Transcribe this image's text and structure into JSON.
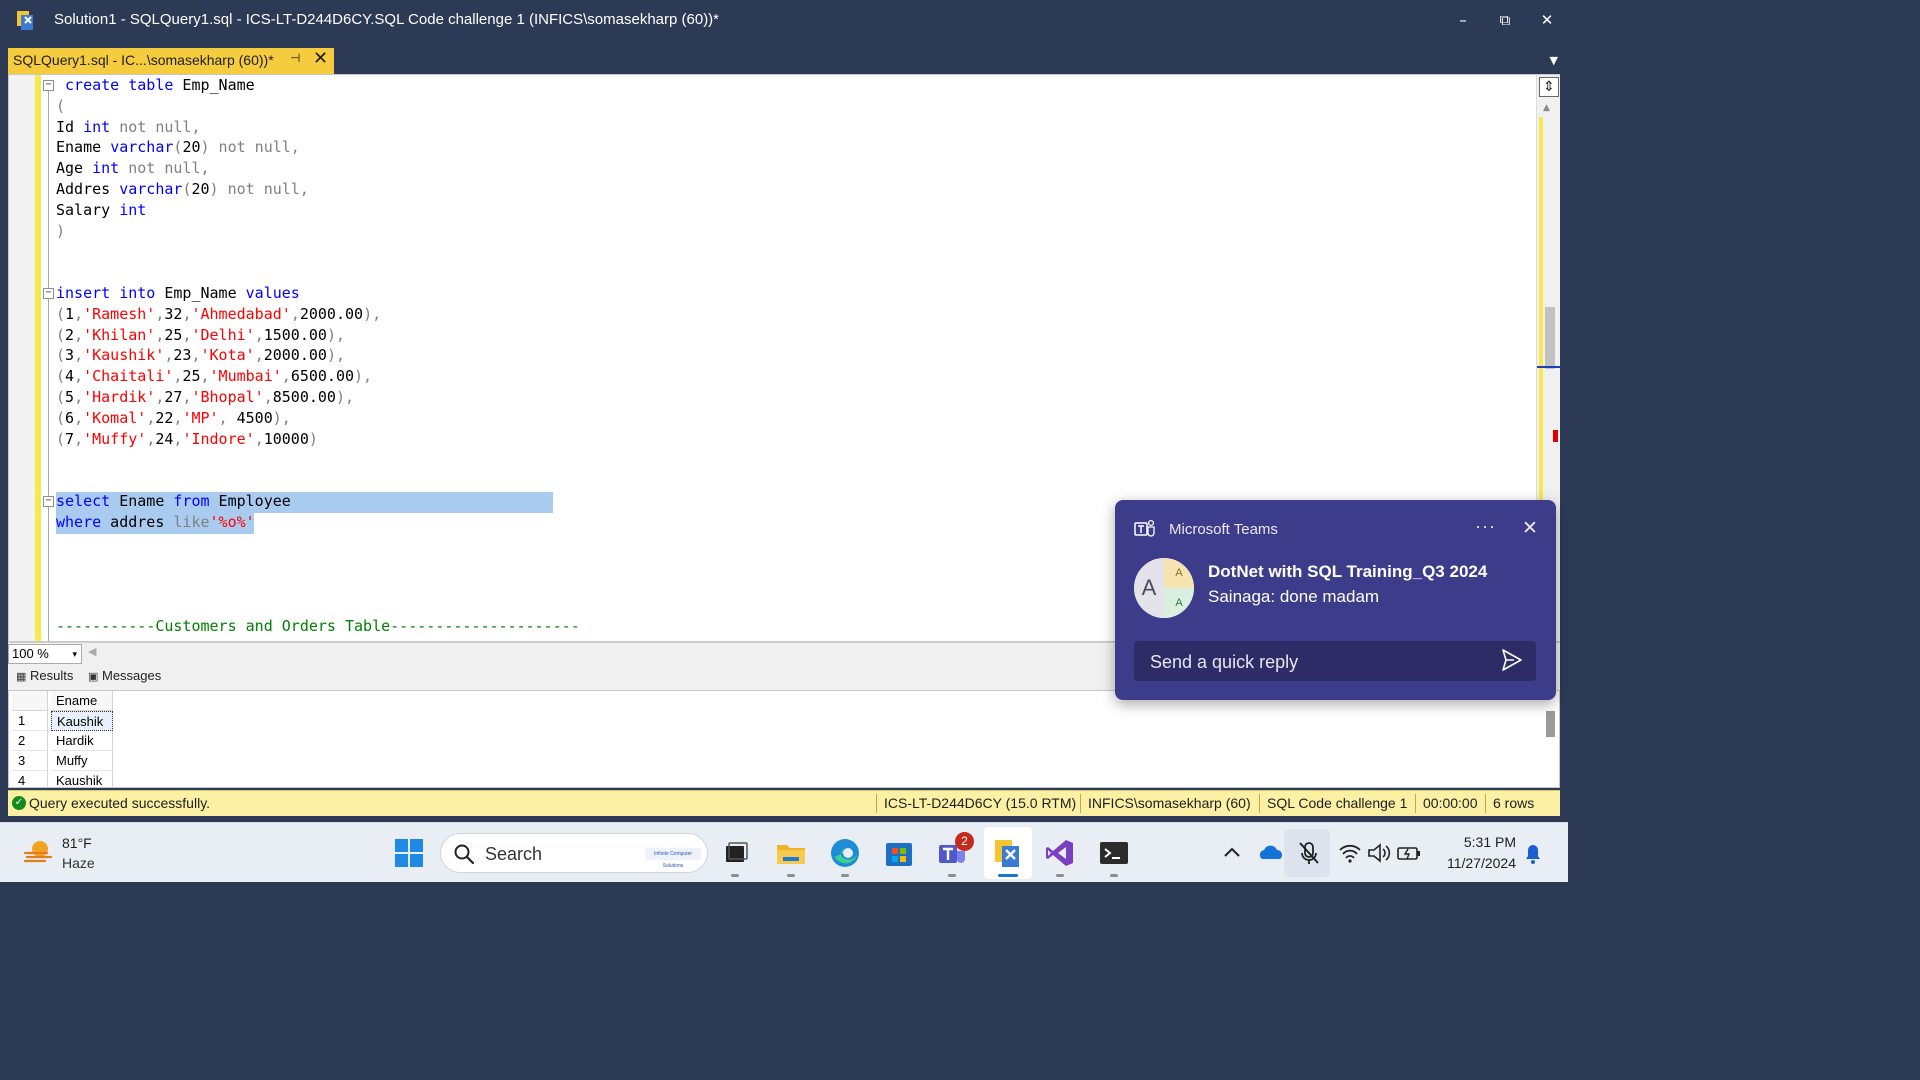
{
  "window": {
    "title": "Solution1 - SQLQuery1.sql - ICS-LT-D244D6CY.SQL Code challenge 1 (INFICS\\somasekharp (60))*",
    "minimize_glyph": "–",
    "restore_glyph": "⧉",
    "close_glyph": "✕"
  },
  "tab": {
    "label": "SQLQuery1.sql - IC...\\somasekharp (60))*",
    "pin_glyph": "⊣",
    "close_glyph": "✕",
    "overflow_glyph": "▼"
  },
  "editor": {
    "lines": [
      {
        "fold": true,
        "segments": [
          [
            "",
            " "
          ],
          [
            "kw",
            "create"
          ],
          [
            "",
            " "
          ],
          [
            "kw",
            "table"
          ],
          [
            "",
            " Emp_Name"
          ]
        ]
      },
      {
        "fold": false,
        "segments": [
          [
            "gr",
            "("
          ]
        ]
      },
      {
        "fold": false,
        "segments": [
          [
            "",
            "Id "
          ],
          [
            "kw",
            "int"
          ],
          [
            "gr",
            " not null,"
          ]
        ]
      },
      {
        "fold": false,
        "segments": [
          [
            "",
            "Ename "
          ],
          [
            "kw",
            "varchar"
          ],
          [
            "gr",
            "("
          ],
          [
            "",
            "20"
          ],
          [
            "gr",
            ") not null,"
          ]
        ]
      },
      {
        "fold": false,
        "segments": [
          [
            "",
            "Age "
          ],
          [
            "kw",
            "int"
          ],
          [
            "gr",
            " not null,"
          ]
        ]
      },
      {
        "fold": false,
        "segments": [
          [
            "",
            "Addres "
          ],
          [
            "kw",
            "varchar"
          ],
          [
            "gr",
            "("
          ],
          [
            "",
            "20"
          ],
          [
            "gr",
            ") not null,"
          ]
        ]
      },
      {
        "fold": false,
        "segments": [
          [
            "",
            "Salary "
          ],
          [
            "kw",
            "int"
          ]
        ]
      },
      {
        "fold": false,
        "segments": [
          [
            "gr",
            ")"
          ]
        ]
      },
      {
        "fold": false,
        "segments": []
      },
      {
        "fold": false,
        "segments": []
      },
      {
        "fold": true,
        "segments": [
          [
            "kw",
            "insert"
          ],
          [
            "",
            " "
          ],
          [
            "kw",
            "into"
          ],
          [
            "",
            " Emp_Name "
          ],
          [
            "kw",
            "values"
          ]
        ]
      },
      {
        "fold": false,
        "segments": [
          [
            "gr",
            "("
          ],
          [
            "",
            "1"
          ],
          [
            "gr",
            ","
          ],
          [
            "st",
            "'Ramesh'"
          ],
          [
            "gr",
            ","
          ],
          [
            "",
            "32"
          ],
          [
            "gr",
            ","
          ],
          [
            "st",
            "'Ahmedabad'"
          ],
          [
            "gr",
            ","
          ],
          [
            "",
            "2000.00"
          ],
          [
            "gr",
            "),"
          ]
        ]
      },
      {
        "fold": false,
        "segments": [
          [
            "gr",
            "("
          ],
          [
            "",
            "2"
          ],
          [
            "gr",
            ","
          ],
          [
            "st",
            "'Khilan'"
          ],
          [
            "gr",
            ","
          ],
          [
            "",
            "25"
          ],
          [
            "gr",
            ","
          ],
          [
            "st",
            "'Delhi'"
          ],
          [
            "gr",
            ","
          ],
          [
            "",
            "1500.00"
          ],
          [
            "gr",
            "),"
          ]
        ]
      },
      {
        "fold": false,
        "segments": [
          [
            "gr",
            "("
          ],
          [
            "",
            "3"
          ],
          [
            "gr",
            ","
          ],
          [
            "st",
            "'Kaushik'"
          ],
          [
            "gr",
            ","
          ],
          [
            "",
            "23"
          ],
          [
            "gr",
            ","
          ],
          [
            "st",
            "'Kota'"
          ],
          [
            "gr",
            ","
          ],
          [
            "",
            "2000.00"
          ],
          [
            "gr",
            "),"
          ]
        ]
      },
      {
        "fold": false,
        "segments": [
          [
            "gr",
            "("
          ],
          [
            "",
            "4"
          ],
          [
            "gr",
            ","
          ],
          [
            "st",
            "'Chaitali'"
          ],
          [
            "gr",
            ","
          ],
          [
            "",
            "25"
          ],
          [
            "gr",
            ","
          ],
          [
            "st",
            "'Mumbai'"
          ],
          [
            "gr",
            ","
          ],
          [
            "",
            "6500.00"
          ],
          [
            "gr",
            "),"
          ]
        ]
      },
      {
        "fold": false,
        "segments": [
          [
            "gr",
            "("
          ],
          [
            "",
            "5"
          ],
          [
            "gr",
            ","
          ],
          [
            "st",
            "'Hardik'"
          ],
          [
            "gr",
            ","
          ],
          [
            "",
            "27"
          ],
          [
            "gr",
            ","
          ],
          [
            "st",
            "'Bhopal'"
          ],
          [
            "gr",
            ","
          ],
          [
            "",
            "8500.00"
          ],
          [
            "gr",
            "),"
          ]
        ]
      },
      {
        "fold": false,
        "segments": [
          [
            "gr",
            "("
          ],
          [
            "",
            "6"
          ],
          [
            "gr",
            ","
          ],
          [
            "st",
            "'Komal'"
          ],
          [
            "gr",
            ","
          ],
          [
            "",
            "22"
          ],
          [
            "gr",
            ","
          ],
          [
            "st",
            "'MP'"
          ],
          [
            "gr",
            ", "
          ],
          [
            "",
            "4500"
          ],
          [
            "gr",
            "),"
          ]
        ]
      },
      {
        "fold": false,
        "segments": [
          [
            "gr",
            "("
          ],
          [
            "",
            "7"
          ],
          [
            "gr",
            ","
          ],
          [
            "st",
            "'Muffy'"
          ],
          [
            "gr",
            ","
          ],
          [
            "",
            "24"
          ],
          [
            "gr",
            ","
          ],
          [
            "st",
            "'Indore'"
          ],
          [
            "gr",
            ","
          ],
          [
            "",
            "10000"
          ],
          [
            "gr",
            ")"
          ]
        ]
      },
      {
        "fold": false,
        "segments": []
      },
      {
        "fold": false,
        "segments": []
      },
      {
        "fold": true,
        "segments": [
          [
            "kw",
            "select"
          ],
          [
            "",
            " Ename "
          ],
          [
            "kw",
            "from"
          ],
          [
            "",
            " Employee"
          ]
        ]
      },
      {
        "fold": false,
        "segments": [
          [
            "kw",
            "where"
          ],
          [
            "",
            " addres "
          ],
          [
            "gr",
            "like"
          ],
          [
            "st",
            "'%o%'"
          ]
        ]
      },
      {
        "fold": false,
        "segments": []
      },
      {
        "fold": false,
        "segments": []
      },
      {
        "fold": false,
        "segments": []
      },
      {
        "fold": false,
        "segments": []
      },
      {
        "fold": false,
        "segments": [
          [
            "cm",
            "-----------Customers and Orders Table---------------------"
          ]
        ]
      }
    ]
  },
  "zoom": {
    "value": "100 %",
    "arrow_glyph": "▾"
  },
  "results": {
    "tabs": [
      {
        "icon": "grid-icon",
        "glyph": "▦",
        "label": "Results"
      },
      {
        "icon": "messages-icon",
        "glyph": "▣",
        "label": "Messages"
      }
    ],
    "column_header": "Ename",
    "rows": [
      {
        "num": "1",
        "ename": "Kaushik"
      },
      {
        "num": "2",
        "ename": "Hardik"
      },
      {
        "num": "3",
        "ename": "Muffy"
      },
      {
        "num": "4",
        "ename": "Kaushik"
      }
    ]
  },
  "status": {
    "check_glyph": "✓",
    "message": "Query executed successfully.",
    "server": "ICS-LT-D244D6CY (15.0 RTM)",
    "user": "INFICS\\somasekharp (60)",
    "database": "SQL Code challenge 1",
    "elapsed": "00:00:00",
    "rows": "6 rows"
  },
  "toast": {
    "app_name": "Microsoft Teams",
    "more_glyph": "···",
    "close_glyph": "✕",
    "avatar_letter": "A",
    "avatar_sub1": "A",
    "avatar_sub2": "A",
    "title": "DotNet with SQL Training_Q3 2024",
    "message": "Sainaga: done madam",
    "reply_placeholder": "Send a quick reply"
  },
  "taskbar": {
    "weather_temp": "81°F",
    "weather_desc": "Haze",
    "search_label": "Search",
    "search_badge": "Infinite Computer Solutions",
    "teams_badge": "2",
    "time": "5:31 PM",
    "date": "11/27/2024",
    "colors": {
      "accent": "#1a73d1",
      "badge": "#c42b1c"
    }
  },
  "colors": {
    "title_bar": "#2d3a55",
    "tab_active": "#f5cc3d",
    "keyword": "#0000ff",
    "string": "#ff0000",
    "operator": "#808080",
    "comment": "#008000",
    "selection": "#a9cbf0",
    "status_bar": "#fbf0a3",
    "toast_bg": "#3d3c8a"
  }
}
